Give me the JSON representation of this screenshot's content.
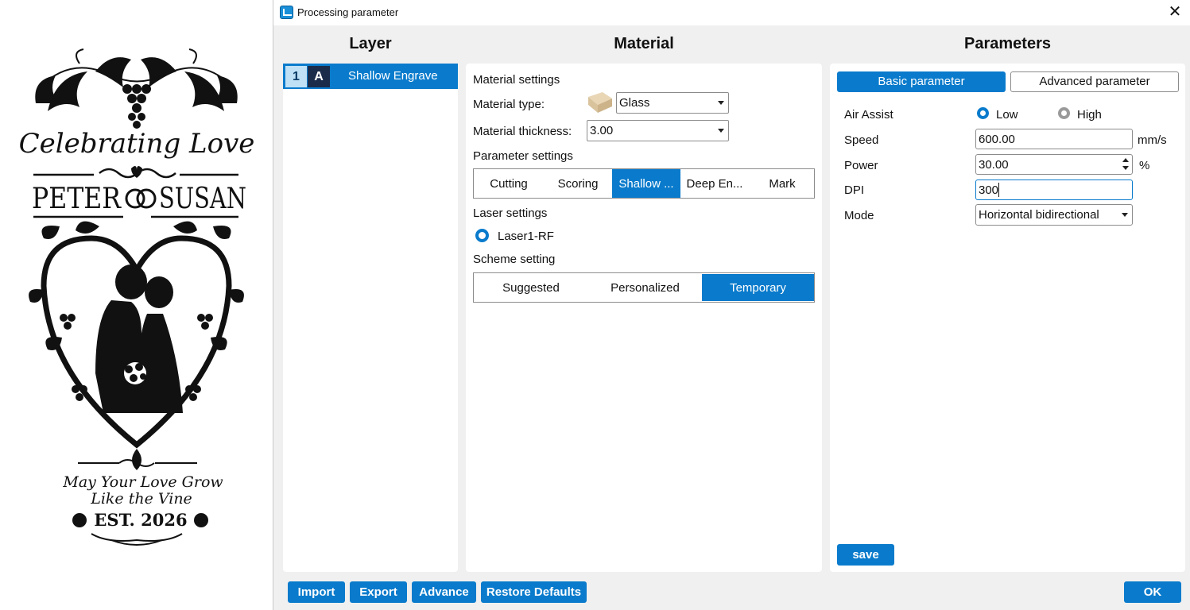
{
  "artwork": {
    "title_script": "Celebrating Love",
    "name_left": "PETER",
    "name_right": "SUSAN",
    "tagline_line1": "May Your Love Grow",
    "tagline_line2": "Like the Vine",
    "established": "EST. 2026"
  },
  "window": {
    "title": "Processing parameter"
  },
  "headers": {
    "layer": "Layer",
    "material": "Material",
    "parameters": "Parameters"
  },
  "layer": {
    "number": "1",
    "mode": "A",
    "name": "Shallow Engrave"
  },
  "material": {
    "settings_heading": "Material settings",
    "type_label": "Material type:",
    "type_value": "Glass",
    "thickness_label": "Material thickness:",
    "thickness_value": "3.00",
    "param_heading": "Parameter settings",
    "param_tabs": [
      "Cutting",
      "Scoring",
      "Shallow ...",
      "Deep En...",
      "Mark"
    ],
    "param_selected": 2,
    "laser_heading": "Laser settings",
    "laser_option": "Laser1-RF",
    "scheme_heading": "Scheme setting",
    "scheme_tabs": [
      "Suggested",
      "Personalized",
      "Temporary"
    ],
    "scheme_selected": 2
  },
  "parameters": {
    "tab_basic": "Basic parameter",
    "tab_advanced": "Advanced parameter",
    "air_assist_label": "Air Assist",
    "air_low": "Low",
    "air_high": "High",
    "speed_label": "Speed",
    "speed_value": "600.00",
    "speed_unit": "mm/s",
    "power_label": "Power",
    "power_value": "30.00",
    "power_unit": "%",
    "dpi_label": "DPI",
    "dpi_value": "300",
    "mode_label": "Mode",
    "mode_value": "Horizontal bidirectional",
    "save_label": "save"
  },
  "footer": {
    "import": "Import",
    "export": "Export",
    "advance": "Advance",
    "restore": "Restore Defaults",
    "ok": "OK"
  },
  "colors": {
    "accent": "#0a7bcc",
    "panel_bg": "#f0f0f0",
    "layer_mode_bg": "#1b2c4b"
  }
}
